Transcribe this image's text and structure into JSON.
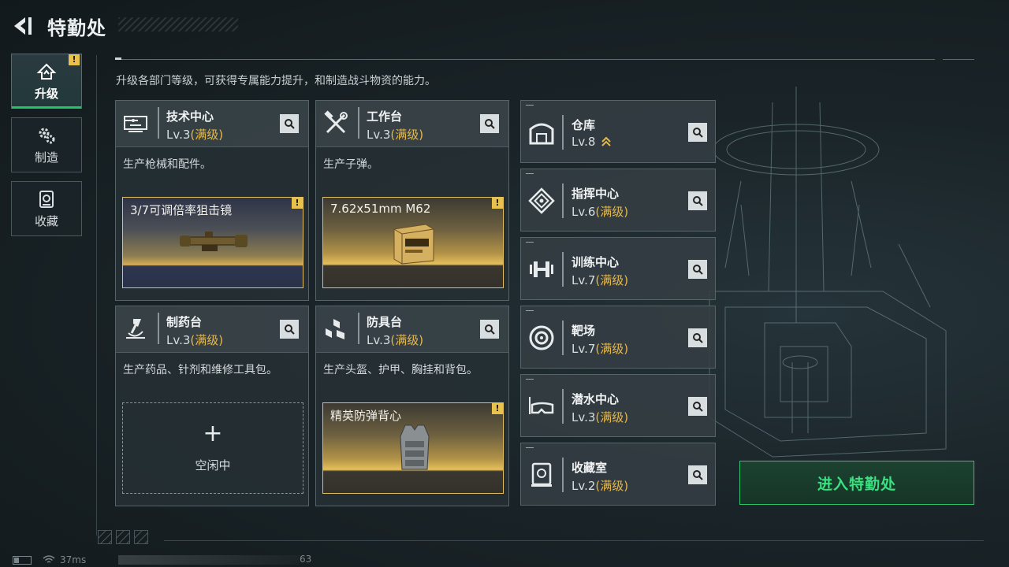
{
  "header": {
    "title": "特勤处"
  },
  "subtitle": "升级各部门等级，可获得专属能力提升，和制造战斗物资的能力。",
  "side_nav": [
    {
      "label": "升级",
      "icon": "upgrade-icon",
      "active": true,
      "warning": "!"
    },
    {
      "label": "制造",
      "icon": "gears-icon",
      "active": false
    },
    {
      "label": "收藏",
      "icon": "collection-icon",
      "active": false
    }
  ],
  "main_cards": [
    {
      "name": "技术中心",
      "level": "Lv.3",
      "status": "(满级)",
      "icon": "tech-center-icon",
      "desc": "生产枪械和配件。",
      "craft": {
        "name": "3/7可调倍率狙击镜",
        "warning": "!"
      }
    },
    {
      "name": "工作台",
      "level": "Lv.3",
      "status": "(满级)",
      "icon": "workbench-icon",
      "desc": "生产子弹。",
      "craft": {
        "name": "7.62x51mm M62",
        "warning": "!"
      }
    },
    {
      "name": "制药台",
      "level": "Lv.3",
      "status": "(满级)",
      "icon": "pharmacy-icon",
      "desc": "生产药品、针剂和维修工具包。",
      "idle": {
        "plus": "+",
        "label": "空闲中"
      }
    },
    {
      "name": "防具台",
      "level": "Lv.3",
      "status": "(满级)",
      "icon": "armor-bench-icon",
      "desc": "生产头盔、护甲、胸挂和背包。",
      "craft": {
        "name": "精英防弹背心",
        "warning": "!"
      }
    }
  ],
  "facilities": [
    {
      "name": "仓库",
      "level": "Lv.8",
      "status": "",
      "icon": "warehouse-icon",
      "upgrade_available": true
    },
    {
      "name": "指挥中心",
      "level": "Lv.6",
      "status": "(满级)",
      "icon": "command-center-icon"
    },
    {
      "name": "训练中心",
      "level": "Lv.7",
      "status": "(满级)",
      "icon": "dumbbell-icon"
    },
    {
      "name": "靶场",
      "level": "Lv.7",
      "status": "(满级)",
      "icon": "target-icon"
    },
    {
      "name": "潜水中心",
      "level": "Lv.3",
      "status": "(满级)",
      "icon": "diving-mask-icon"
    },
    {
      "name": "收藏室",
      "level": "Lv.2",
      "status": "(满级)",
      "icon": "collection-room-icon"
    }
  ],
  "enter_button": "进入特勤处",
  "status_bar": {
    "ping": "37ms",
    "fps": "63"
  },
  "colors": {
    "accent_green": "#2ec46e",
    "max_level_gold": "#e5b84a",
    "warning_yellow": "#e8c24a"
  }
}
